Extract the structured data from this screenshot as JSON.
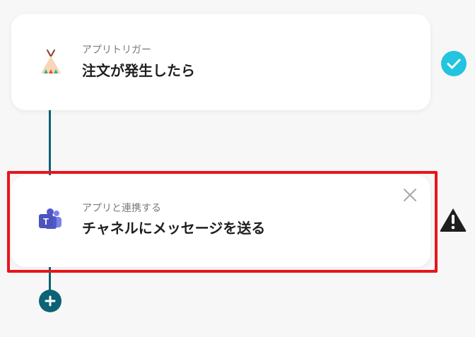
{
  "steps": [
    {
      "type_label": "アプリトリガー",
      "title": "注文が発生したら",
      "app_icon": "tent-icon",
      "status": "complete"
    },
    {
      "type_label": "アプリと連携する",
      "title": "チャネルにメッセージを送る",
      "app_icon": "teams-icon",
      "status": "warning"
    }
  ],
  "colors": {
    "connector": "#0d6275",
    "check": "#22c4e0",
    "highlight": "#e8141c",
    "warning": "#1f1f1f"
  },
  "icons": {
    "complete": "check-circle-icon",
    "warning": "warning-icon",
    "close": "close-icon",
    "add": "plus-icon"
  }
}
